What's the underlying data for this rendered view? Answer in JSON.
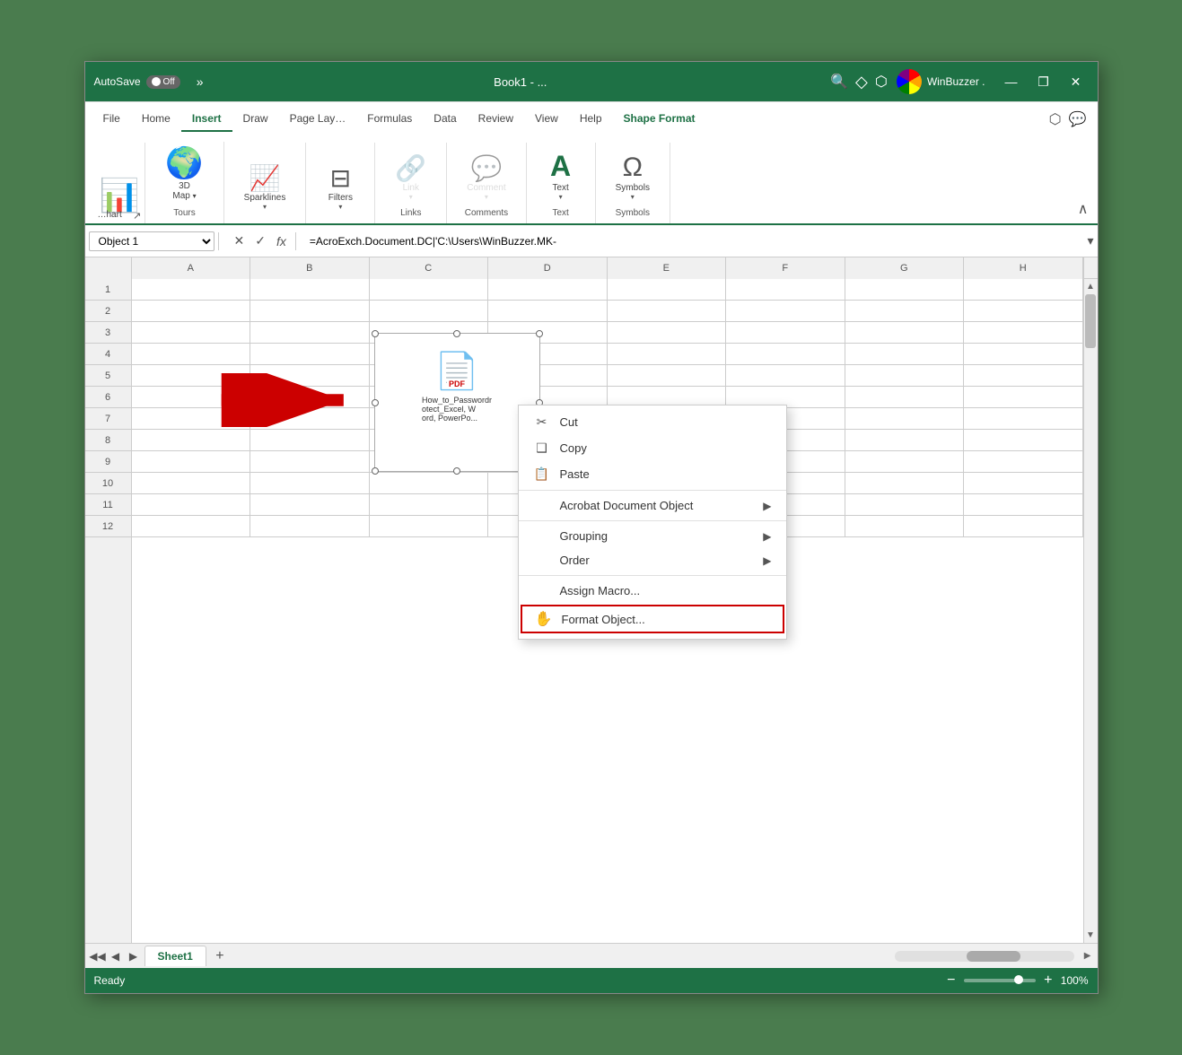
{
  "titleBar": {
    "autosave_label": "AutoSave",
    "toggle_label": "Off",
    "more_btn": "»",
    "filename": "Book1 - ...",
    "search_placeholder": "Search",
    "user_label": "WinBuzzer .",
    "minimize": "—",
    "restore": "❐",
    "close": "✕",
    "diamond_icon": "◇",
    "share_icon": "⬡"
  },
  "ribbonTabs": {
    "tabs": [
      {
        "id": "file",
        "label": "File"
      },
      {
        "id": "home",
        "label": "Home"
      },
      {
        "id": "insert",
        "label": "Insert",
        "active": true
      },
      {
        "id": "draw",
        "label": "Draw"
      },
      {
        "id": "pagelayout",
        "label": "Page Lay…"
      },
      {
        "id": "formulas",
        "label": "Formulas"
      },
      {
        "id": "data",
        "label": "Data"
      },
      {
        "id": "review",
        "label": "Review"
      },
      {
        "id": "view",
        "label": "View"
      },
      {
        "id": "help",
        "label": "Help"
      },
      {
        "id": "shapeformat",
        "label": "Shape Format",
        "special": true
      }
    ]
  },
  "ribbon": {
    "groups": {
      "tours": {
        "label": "Tours",
        "items": [
          {
            "id": "map3d",
            "icon": "🌍",
            "label": "3D\nMap",
            "arrow": true
          },
          {
            "id": "corner",
            "icon": "↗",
            "is_corner": true
          }
        ]
      },
      "sparklines": {
        "label": "Sparklines",
        "icon": "📈",
        "label_text": "Sparklines",
        "arrow": true
      },
      "filters": {
        "label": "Filters",
        "icon": "⊟",
        "label_text": "Filters",
        "arrow": true
      },
      "links": {
        "label": "Links",
        "icon": "🔗",
        "label_text": "Links",
        "arrow": true,
        "group_label": "Links",
        "disabled": true
      },
      "comments": {
        "label": "Comments",
        "icon": "💬",
        "label_text": "Comment",
        "arrow": true,
        "group_label": "Comments",
        "disabled": true
      },
      "text": {
        "label": "Text",
        "icon": "A",
        "label_text": "Text",
        "arrow": true,
        "group_label": "Text",
        "color": "#1e7145"
      },
      "symbols": {
        "label": "Symbols",
        "icon": "Ω",
        "label_text": "Symbols",
        "arrow": true,
        "group_label": "Symbols"
      }
    }
  },
  "formulaBar": {
    "nameBox": "Object 1",
    "cancelBtn": "✕",
    "confirmBtn": "✓",
    "fxLabel": "fx",
    "formula": "=AcroExch.Document.DC|'C:\\Users\\WinBuzzer.MK-"
  },
  "columns": [
    "A",
    "B",
    "C",
    "D",
    "E",
    "F",
    "G",
    "H"
  ],
  "rows": [
    1,
    2,
    3,
    4,
    5,
    6,
    7,
    8,
    9,
    10,
    11,
    12
  ],
  "pdfObject": {
    "icon": "📄",
    "badge": "PDF",
    "filename": "How_to_Passwordrotect_Excel, Word, PowerPo..."
  },
  "contextMenu": {
    "items": [
      {
        "id": "cut",
        "icon": "✂",
        "label": "Cut"
      },
      {
        "id": "copy",
        "icon": "❑",
        "label": "Copy"
      },
      {
        "id": "paste",
        "icon": "📋",
        "label": "Paste"
      },
      {
        "id": "separator1"
      },
      {
        "id": "acrobat",
        "icon": "",
        "label": "Acrobat Document Object",
        "arrow": "▶"
      },
      {
        "id": "separator2"
      },
      {
        "id": "grouping",
        "icon": "",
        "label": "Grouping",
        "arrow": "▶"
      },
      {
        "id": "order",
        "icon": "",
        "label": "Order",
        "arrow": "▶"
      },
      {
        "id": "separator3"
      },
      {
        "id": "assignmacro",
        "icon": "",
        "label": "Assign Macro..."
      },
      {
        "id": "formatobject",
        "icon": "✋",
        "label": "Format Object...",
        "highlighted": true
      }
    ]
  },
  "sheetTabs": {
    "tabs": [
      {
        "id": "sheet1",
        "label": "Sheet1",
        "active": true
      }
    ],
    "add_btn": "+"
  },
  "statusBar": {
    "ready": "Ready",
    "zoom_minus": "−",
    "zoom_plus": "+",
    "zoom_level": "100%"
  }
}
